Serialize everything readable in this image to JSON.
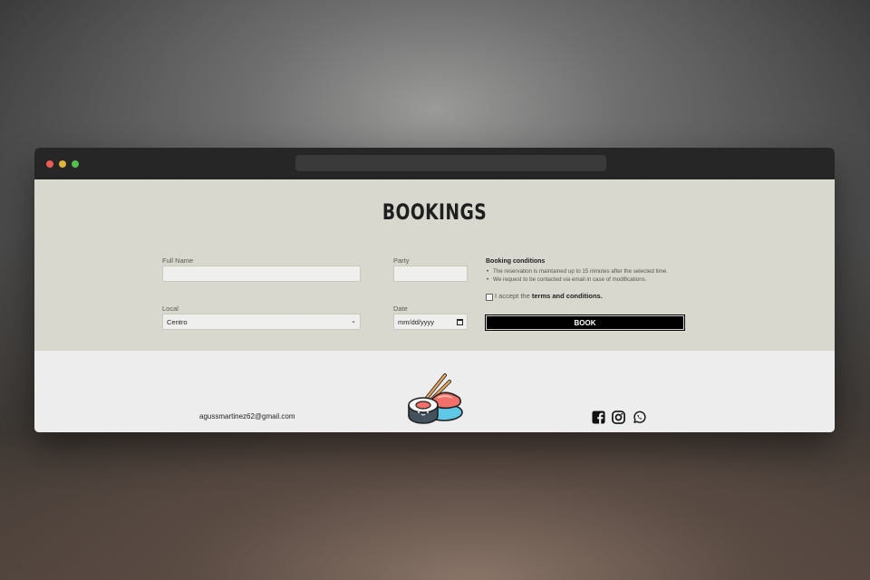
{
  "page": {
    "title": "BOOKINGS"
  },
  "form": {
    "full_name": {
      "label": "Full Name",
      "value": ""
    },
    "party": {
      "label": "Party",
      "value": ""
    },
    "local": {
      "label": "Local",
      "selected": "Centro"
    },
    "date": {
      "label": "Date",
      "placeholder": "mm/dd/yyyy"
    }
  },
  "conditions": {
    "title": "Booking conditions",
    "items": [
      "The reservation is maintained up to 15 minutes after the selected time.",
      "We request to be contacted via email in case of modifications."
    ],
    "accept_prefix": "I accept the ",
    "accept_link": "terms and conditions."
  },
  "book_button": "BOOK",
  "footer": {
    "email": "agussmartinez62@gmail.com",
    "logo_icon": "sushi-logo-icon",
    "social_icons": [
      "facebook-icon",
      "instagram-icon",
      "whatsapp-icon"
    ]
  },
  "colors": {
    "content_bg": "#d8d8cf",
    "footer_bg": "#ededed",
    "button_bg": "#000000",
    "titlebar_bg": "#262626"
  }
}
